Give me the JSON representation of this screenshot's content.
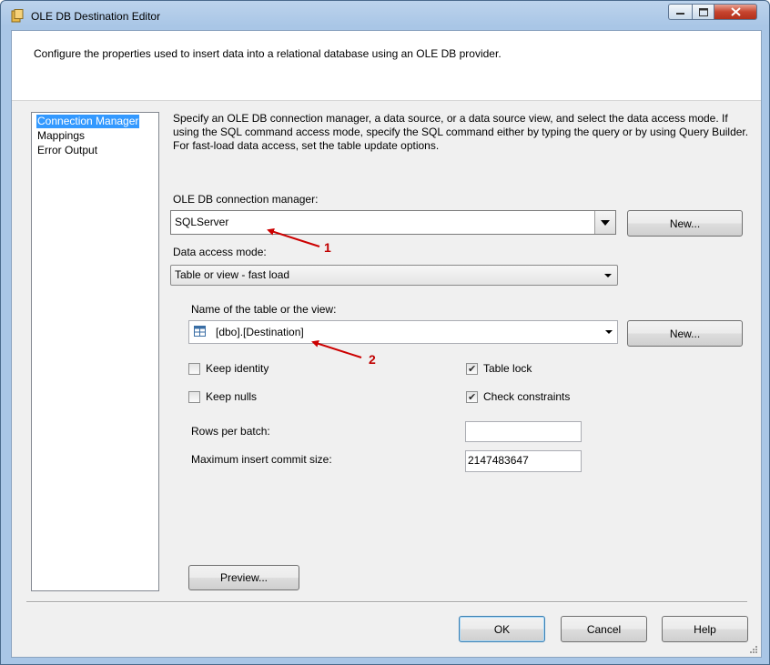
{
  "window": {
    "title": "OLE DB Destination Editor"
  },
  "header": {
    "description": "Configure the properties used to insert data into a relational database using an OLE DB provider."
  },
  "nav": {
    "items": [
      {
        "label": "Connection Manager",
        "selected": true
      },
      {
        "label": "Mappings",
        "selected": false
      },
      {
        "label": "Error Output",
        "selected": false
      }
    ]
  },
  "main": {
    "description": "Specify an OLE DB connection manager, a data source, or a data source view, and select the data access mode. If using the SQL command access mode, specify the SQL command either by typing the query or by using Query Builder. For fast-load data access, set the table update options.",
    "connection_label": "OLE DB connection manager:",
    "connection_value": "SQLServer",
    "connection_new_label": "New...",
    "access_mode_label": "Data access mode:",
    "access_mode_value": "Table or view - fast load",
    "table_label": "Name of the table or the view:",
    "table_value": "[dbo].[Destination]",
    "table_new_label": "New...",
    "options": {
      "keep_identity": {
        "label": "Keep identity",
        "checked": false
      },
      "table_lock": {
        "label": "Table lock",
        "checked": true
      },
      "keep_nulls": {
        "label": "Keep nulls",
        "checked": false
      },
      "check_constraints": {
        "label": "Check constraints",
        "checked": true
      }
    },
    "rows_per_batch_label": "Rows per batch:",
    "rows_per_batch_value": "",
    "max_commit_label": "Maximum insert commit size:",
    "max_commit_value": "2147483647",
    "preview_label": "Preview..."
  },
  "annotations": {
    "arrow1": "1",
    "arrow2": "2",
    "color": "#cc0000"
  },
  "footer": {
    "ok_label": "OK",
    "cancel_label": "Cancel",
    "help_label": "Help"
  },
  "icons": {
    "title": "package-icon",
    "table": "table-icon"
  },
  "colors": {
    "selection": "#3399ff",
    "titlebar": "#a9c6e6",
    "close": "#c7452f"
  }
}
